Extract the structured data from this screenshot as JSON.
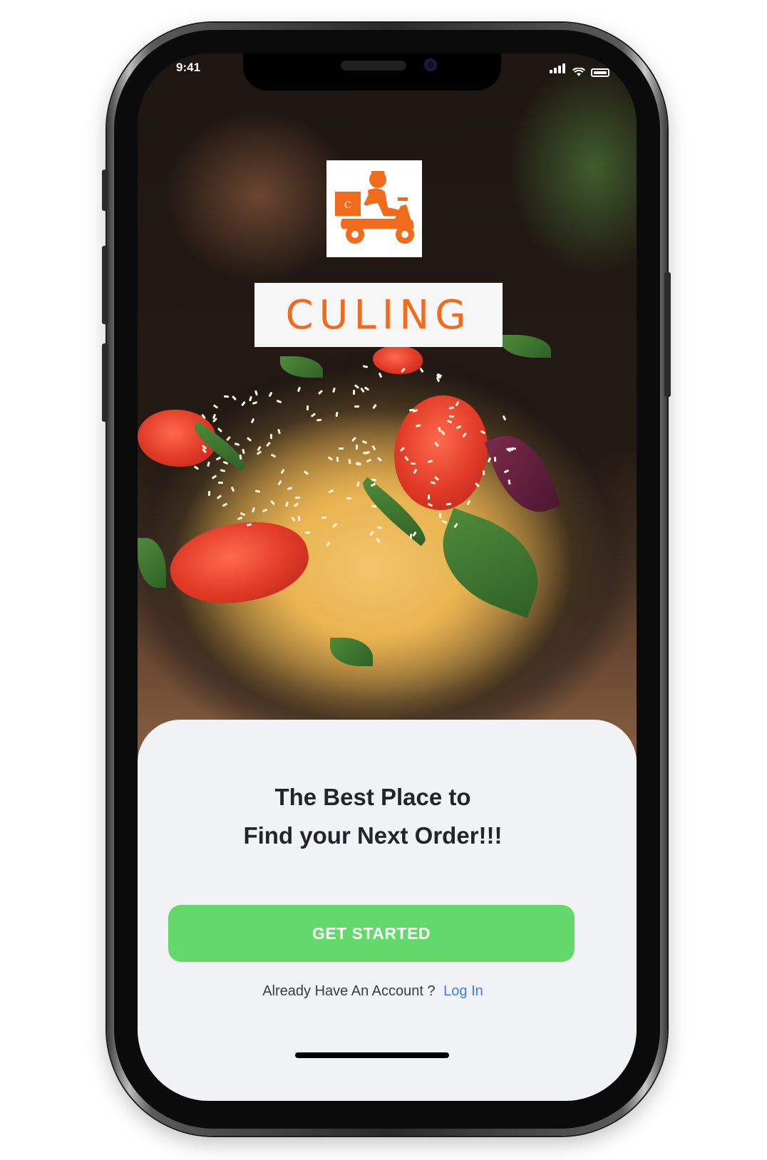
{
  "status_bar": {
    "time": "9:41"
  },
  "brand": {
    "name": "CULING",
    "logo_icon": "delivery-scooter-icon",
    "logo_box_letter": "C",
    "accent_color": "#f26a1b"
  },
  "hero": {
    "image": "pasta-bowl-photo"
  },
  "sheet": {
    "headline_line1": "The Best Place to",
    "headline_line2": "Find your Next Order!!!",
    "cta_label": "GET STARTED",
    "cta_color": "#63d96b",
    "login_prompt": "Already Have An Account ?",
    "login_link": "Log In",
    "link_color": "#3a7df0"
  }
}
